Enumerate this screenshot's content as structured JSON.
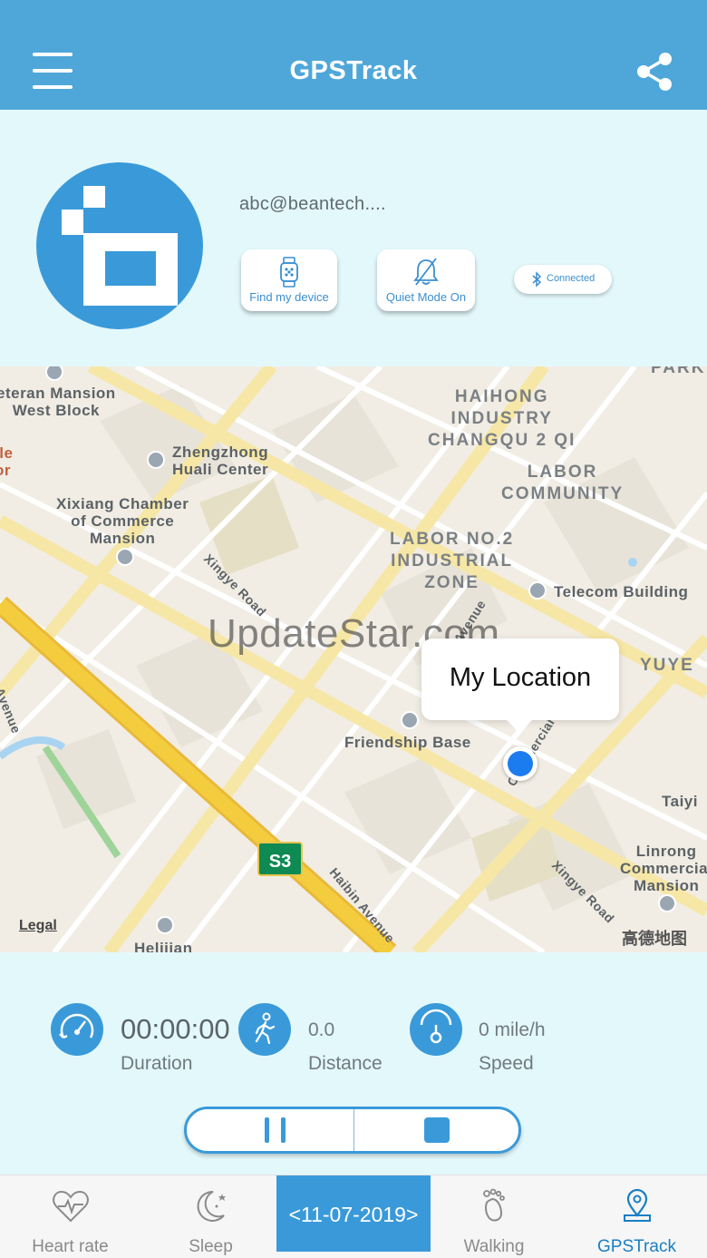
{
  "header": {
    "title": "GPSTrack",
    "menu_icon": "hamburger-menu-icon",
    "share_icon": "share-icon"
  },
  "profile": {
    "email": "abc@beantech....",
    "buttons": {
      "find_device": "Find my device",
      "quiet_mode": "Quiet Mode On",
      "connection": "Connected"
    }
  },
  "map": {
    "labels": {
      "veteran": "eteran Mansion\nWest Block",
      "zhengzhong": "Zhengzhong\nHuali Center",
      "xixiang": "Xixiang Chamber\nof Commerce\nMansion",
      "haihong": "HAIHONG\nINDUSTRY\nCHANGQU 2 QI",
      "labor_comm": "LABOR\nCOMMUNITY",
      "labor_no2": "LABOR NO.2\nINDUSTRIAL\nZONE",
      "telecom": "Telecom Building",
      "friendship": "Friendship Base",
      "taiyi": "Taiyi",
      "linrong": "Linrong\nCommercial\nMansion",
      "yuye": "YUYE",
      "park": "PARK",
      "heljian": "Helijian",
      "xingye_rd_1": "Xingye Road",
      "xingye_rd_2": "Xingye Road",
      "haibin": "Haibin Avenue",
      "avenue_left": "Avenue",
      "avenue_mid": "Avenue",
      "commercial": "Commercial S",
      "le_left": "lle\nor\nt"
    },
    "highway_shield": "S3",
    "watermark": "UpdateStar.com",
    "bubble": "My Location",
    "legal": "Legal",
    "provider": "高德地图"
  },
  "stats": {
    "duration_value": "00:00:00",
    "duration_label": "Duration",
    "distance_value": "0.0",
    "distance_label": "Distance",
    "speed_value": "0 mile/h",
    "speed_label": "Speed"
  },
  "tabs": {
    "heart_rate": "Heart rate",
    "sleep": "Sleep",
    "date": "<11-07-2019>",
    "walking": "Walking",
    "gpstrack": "GPSTrack"
  },
  "colors": {
    "header": "#4fa7d9",
    "accent": "#3a9ad9",
    "background": "#e3f8fb",
    "active_tab": "#1a7fc4"
  }
}
